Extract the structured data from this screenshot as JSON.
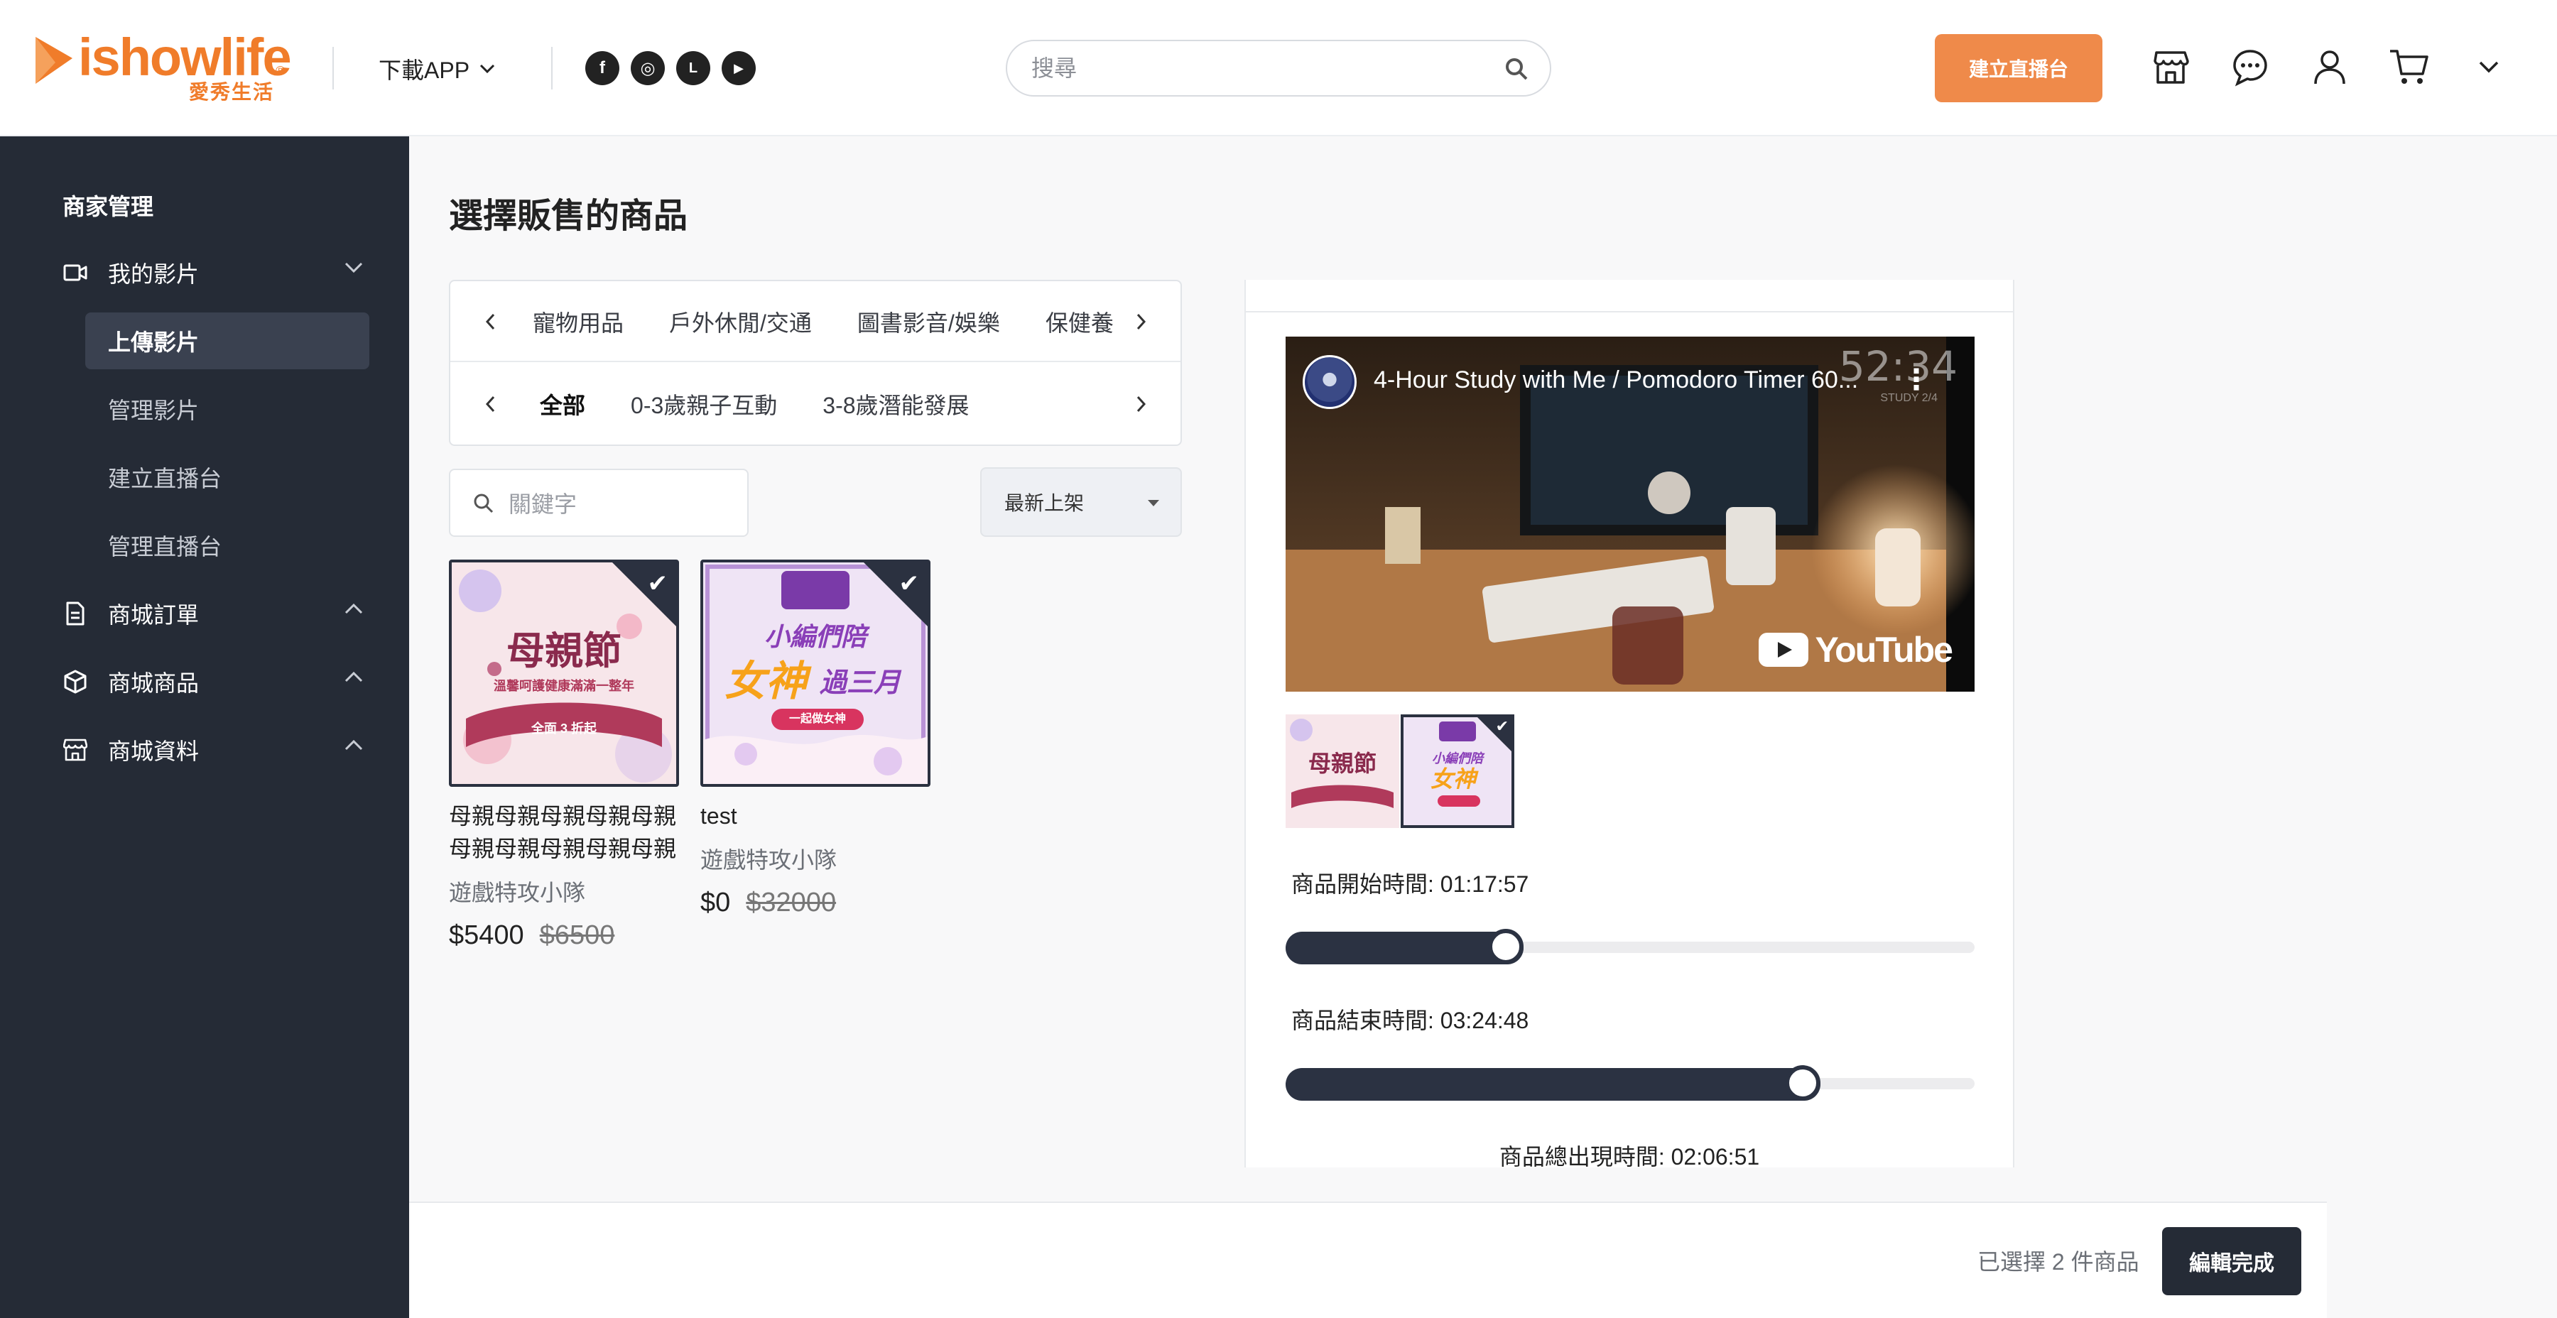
{
  "header": {
    "logo_text": "ishowlife",
    "logo_sub": "愛秀生活",
    "logo_reg": "®",
    "download_app": "下載APP",
    "social": [
      {
        "icon": "facebook-icon",
        "glyph": "f"
      },
      {
        "icon": "instagram-icon",
        "glyph": "◎"
      },
      {
        "icon": "line-icon",
        "glyph": "L"
      },
      {
        "icon": "youtube-icon",
        "glyph": "▶"
      }
    ],
    "search_placeholder": "搜尋",
    "create_live_button": "建立直播台",
    "icons": [
      "store-icon",
      "chat-icon",
      "user-icon",
      "cart-icon",
      "chevron-down-icon"
    ],
    "accent_color": "#EF8A4A"
  },
  "sidebar": {
    "title": "商家管理",
    "groups": [
      {
        "label": "我的影片",
        "icon": "video-icon",
        "expanded": true
      },
      {
        "label": "商城訂單",
        "icon": "order-icon",
        "expanded": false
      },
      {
        "label": "商城商品",
        "icon": "box-icon",
        "expanded": false
      },
      {
        "label": "商城資料",
        "icon": "store-icon",
        "expanded": false
      }
    ],
    "items": [
      "上傳影片",
      "管理影片",
      "建立直播台",
      "管理直播台"
    ],
    "active_item": "上傳影片"
  },
  "main": {
    "title": "選擇販售的商品",
    "categories_row1": [
      "寵物用品",
      "戶外休閒/交通",
      "圖書影音/娛樂",
      "保健養"
    ],
    "categories_row2": [
      "全部",
      "0-3歲親子互動",
      "3-8歲潛能發展"
    ],
    "selected_category": "全部",
    "keyword_placeholder": "關鍵字",
    "sort_value": "最新上架",
    "products": [
      {
        "name": "母親母親母親母親母親母親母親母親母親母親母親…",
        "shop": "遊戲特攻小隊",
        "price": "$5400",
        "original_price": "$6500",
        "selected": true,
        "image_lines": [
          "母親節",
          "溫馨呵護健康滿滿一整年",
          "全面 3 折起"
        ]
      },
      {
        "name": "test",
        "shop": "遊戲特攻小隊",
        "price": "$0",
        "original_price": "$32000",
        "selected": true,
        "image_lines": [
          "小編們陪",
          "女神",
          "過三月",
          "一起做女神"
        ]
      }
    ]
  },
  "preview": {
    "video_title": "4-Hour Study with Me / Pomodoro Timer 60...",
    "video_timer": "52:34",
    "video_timer_sub": "STUDY 2/4",
    "youtube_label": "YouTube",
    "start_label": "商品開始時間: 01:17:57",
    "start_fraction": 0.32,
    "end_label": "商品結束時間: 03:24:48",
    "end_fraction": 0.75,
    "total_label": "商品總出現時間: 02:06:51"
  },
  "footer": {
    "selected_count": "已選擇 2 件商品",
    "done_button": "編輯完成"
  }
}
